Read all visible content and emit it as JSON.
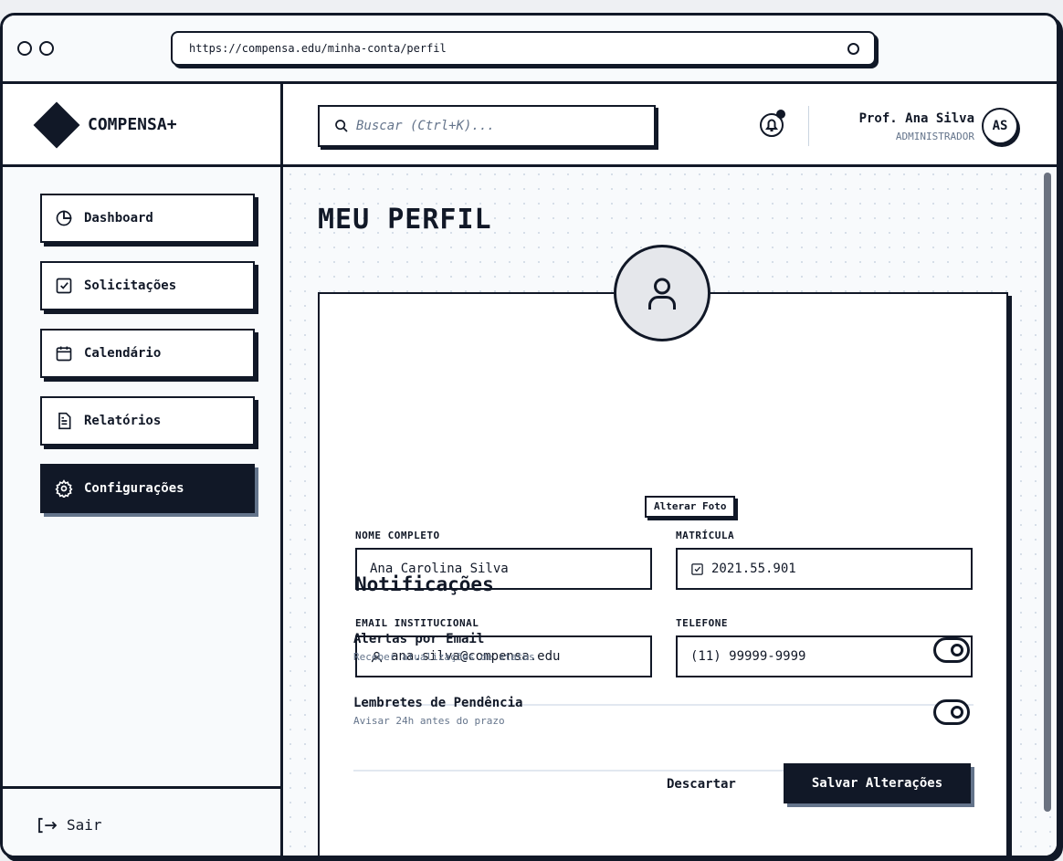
{
  "browser": {
    "url": "https://compensa.edu/minha-conta/perfil"
  },
  "brand": {
    "name": "COMPENSA+"
  },
  "sidebar": {
    "items": [
      {
        "label": "Dashboard",
        "icon": "pie-chart-icon"
      },
      {
        "label": "Solicitações",
        "icon": "checkbox-icon"
      },
      {
        "label": "Calendário",
        "icon": "calendar-icon"
      },
      {
        "label": "Relatórios",
        "icon": "document-icon"
      },
      {
        "label": "Configurações",
        "icon": "gear-icon",
        "active": true
      }
    ],
    "logout_label": "Sair"
  },
  "topbar": {
    "search_placeholder": "Buscar (Ctrl+K)...",
    "user_name": "Prof. Ana Silva",
    "user_role": "ADMINISTRADOR",
    "avatar_initials": "AS"
  },
  "page": {
    "title": "MEU PERFIL"
  },
  "profile": {
    "change_photo_label": "Alterar Foto",
    "fields": {
      "name_label": "NOME COMPLETO",
      "name_value": "Ana Carolina Silva",
      "matricula_label": "MATRÍCULA",
      "matricula_value": "2021.55.901",
      "email_label": "EMAIL INSTITUCIONAL",
      "email_value": "ana.silva@compensa.edu",
      "phone_label": "TELEFONE",
      "phone_value": "(11) 99999-9999"
    },
    "notifications": {
      "title": "Notificações",
      "options": [
        {
          "title": "Alertas por Email",
          "subtitle": "Receber atualizações de status",
          "enabled": true
        },
        {
          "title": "Lembretes de Pendência",
          "subtitle": "Avisar 24h antes do prazo",
          "enabled": true
        }
      ]
    },
    "actions": {
      "discard_label": "Descartar",
      "save_label": "Salvar Alterações"
    }
  },
  "colors": {
    "ink": "#111827",
    "muted": "#64748b",
    "background": "#f8fafc"
  }
}
